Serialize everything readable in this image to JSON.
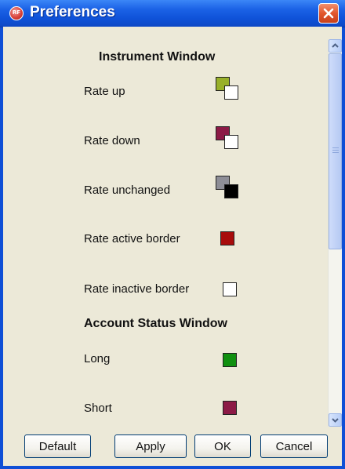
{
  "window": {
    "title": "Preferences",
    "logo_text": "RF"
  },
  "instrument_window": {
    "heading": "Instrument Window",
    "items": [
      {
        "label": "Rate up",
        "colors": [
          "#98b02a",
          "#ffffff"
        ]
      },
      {
        "label": "Rate down",
        "colors": [
          "#8c1a46",
          "#ffffff"
        ]
      },
      {
        "label": "Rate unchanged",
        "colors": [
          "#8e8e97",
          "#000000"
        ]
      },
      {
        "label": "Rate active border",
        "color": "#a80c0c"
      },
      {
        "label": "Rate inactive border",
        "color": "#ffffff"
      }
    ]
  },
  "account_status_window": {
    "heading": "Account Status Window",
    "items": [
      {
        "label": "Long",
        "color": "#109010"
      },
      {
        "label": "Short",
        "color": "#8c1a46"
      }
    ]
  },
  "buttons": {
    "default": "Default",
    "apply": "Apply",
    "ok": "OK",
    "cancel": "Cancel"
  }
}
